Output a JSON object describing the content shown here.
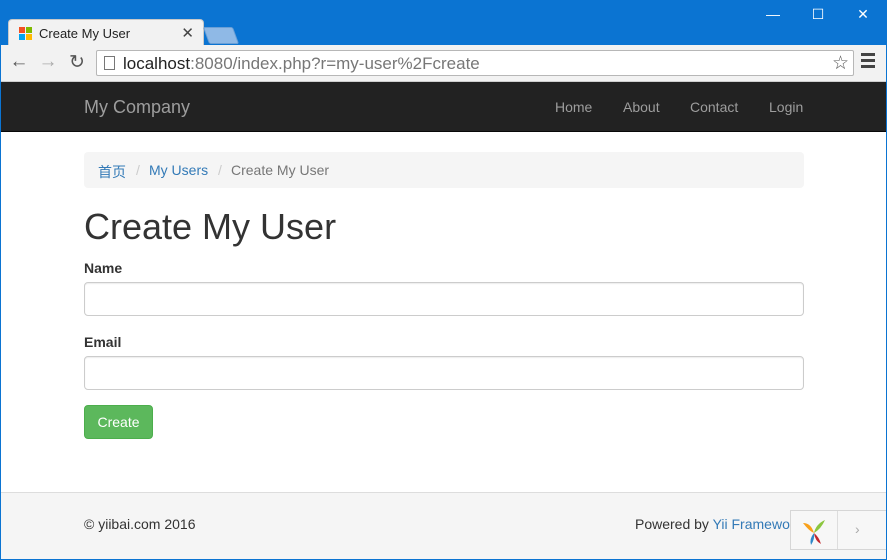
{
  "browser": {
    "tab_title": "Create My User",
    "tab_close": "✕",
    "window_controls": {
      "minimize": "—",
      "maximize": "☐",
      "close": "✕"
    },
    "nav": {
      "back": "←",
      "forward": "→",
      "reload": "↻"
    },
    "address": {
      "host": "localhost",
      "rest": ":8080/index.php?r=my-user%2Fcreate"
    },
    "star": "☆"
  },
  "navbar": {
    "brand": "My Company",
    "links": [
      "Home",
      "About",
      "Contact",
      "Login"
    ]
  },
  "breadcrumb": {
    "items": [
      "首页",
      "My Users",
      "Create My User"
    ],
    "separator": "/"
  },
  "page": {
    "title": "Create My User",
    "fields": [
      {
        "label": "Name",
        "value": ""
      },
      {
        "label": "Email",
        "value": ""
      }
    ],
    "submit_label": "Create"
  },
  "footer": {
    "copyright": "© yiibai.com 2016",
    "powered_prefix": "Powered by ",
    "powered_link": "Yii Framewo"
  },
  "debug_toolbar": {
    "arrow": "›"
  },
  "colors": {
    "titlebar": "#0b74d2",
    "navbar": "#222222",
    "link": "#337ab7",
    "create_button": "#5cb85c"
  }
}
